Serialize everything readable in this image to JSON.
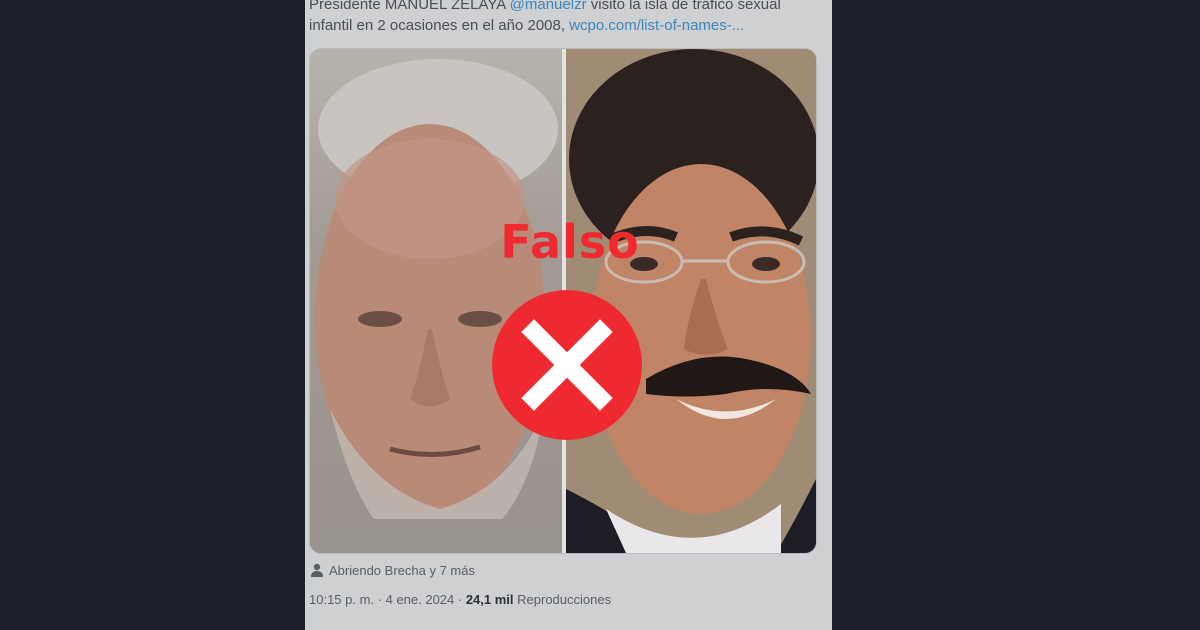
{
  "tweet": {
    "text_line1_prefix": "Presidente MANUEL ZELAYA ",
    "mention": "@manuelzr",
    "text_line1_suffix": " visitó la isla de tráfico sexual",
    "text_line2": "infantil en 2 ocasiones en el año 2008, ",
    "link": "wcpo.com/list-of-names-...",
    "tagged": "Abriendo Brecha y 7 más",
    "time": "10:15 p. m. · 4 ene. 2024 · ",
    "views_count": "24,1 mil",
    "views_label": " Reproducciones"
  },
  "verdict": {
    "label": "Falso",
    "color": "#ee2a30",
    "icon": "close-icon"
  }
}
